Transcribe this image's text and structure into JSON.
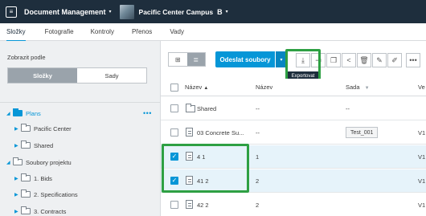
{
  "topbar": {
    "logo_glyph": "≡",
    "app_title": "Document Management",
    "app_caret": "▾",
    "project_name": "Pacific Center Campus",
    "project_badge": "B",
    "project_caret": "▾"
  },
  "tabs": [
    {
      "label": "Složky",
      "active": true
    },
    {
      "label": "Fotografie",
      "active": false
    },
    {
      "label": "Kontroly",
      "active": false
    },
    {
      "label": "Přenos",
      "active": false
    },
    {
      "label": "Vady",
      "active": false
    }
  ],
  "sidebar": {
    "filter_label": "Zobrazit podle",
    "segments": {
      "folders": "Složky",
      "sets": "Sady"
    },
    "more": "•••",
    "tree": {
      "plans": "Plans",
      "pacific_center": "Pacific Center",
      "shared": "Shared",
      "project_files": "Soubory projektu",
      "bids": "1. Bids",
      "specifications": "2. Specifications",
      "contracts": "3. Contracts"
    }
  },
  "toolbar": {
    "grid_view_glyph": "⊞",
    "list_view_glyph": "≣",
    "upload_label": "Odeslat soubory",
    "upload_caret": "▾",
    "export_glyph": "⤓",
    "export_tooltip": "Exportovat",
    "move_glyph": "⇥",
    "copy_glyph": "❐",
    "share_glyph": "<",
    "delete_glyph": "🗑",
    "edit_glyph": "✎",
    "sign_glyph": "✐",
    "more_glyph": "•••"
  },
  "table": {
    "headers": {
      "name": "Název",
      "name_sort": "▲",
      "title": "Název",
      "set": "Sada",
      "set_filter": "▼",
      "version": "Ve"
    },
    "rows": [
      {
        "name": "Shared",
        "title": "--",
        "set": "--",
        "version": "",
        "checked": false,
        "kind": "folder"
      },
      {
        "name": "03 Concrete Su...",
        "title": "--",
        "set": "Test_001",
        "version": "V1",
        "checked": false,
        "kind": "file"
      },
      {
        "name": "4 1",
        "title": "1",
        "set": "",
        "version": "V1",
        "checked": true,
        "kind": "file"
      },
      {
        "name": "41 2",
        "title": "2",
        "set": "",
        "version": "V1",
        "checked": true,
        "kind": "file"
      },
      {
        "name": "42 2",
        "title": "2",
        "set": "",
        "version": "V1",
        "checked": false,
        "kind": "file"
      }
    ]
  },
  "colors": {
    "accent": "#0696d7",
    "topbar": "#1e2e3d",
    "highlight": "#2ea043"
  }
}
